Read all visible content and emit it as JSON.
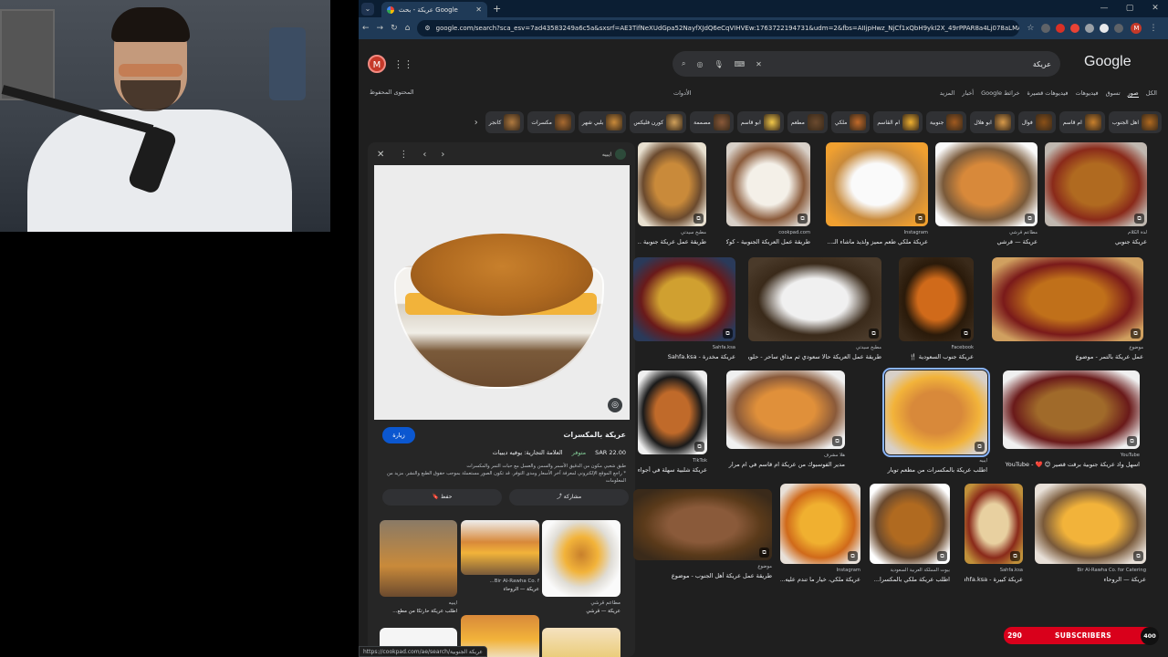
{
  "browser": {
    "tab_title": "عريكة - بحث Google",
    "url": "google.com/search?sca_esv=7ad43583249a6c5a&sxsrf=AE3TifNeXUdGpa52NayfXJdQ6eCqVIHVEw:1763722194731&udm=2&fbs=AIIjpHwz_NjCf1xQbH9ykI2X_49rPPAR8a4Lj078aLMASzH9gHKJW...",
    "status_url": "https://cookpad.com/ae/search/عريكة الجنوبية"
  },
  "google": {
    "logo": "Google",
    "query": "عريكة",
    "avatar_letter": "M",
    "safe_search": "المحتوى المحفوظ",
    "tools": "الأدوات",
    "filters": [
      "الكل",
      "صور",
      "تسوق",
      "فيديوهات",
      "فيديوهات قصيرة",
      "خرائط Google",
      "أخبار",
      "المزيد"
    ],
    "active_filter": "صور"
  },
  "chips": [
    "اهل الجنوب",
    "ام قاسم",
    "فوال",
    "ابو هلال",
    "جنوبية",
    "ام القاسم",
    "ملكي",
    "مطعم",
    "ابو قاسم",
    "مصممة",
    "كورن فليكس",
    "بلبي شهر",
    "مكسرات",
    "كانجر"
  ],
  "preview": {
    "source": "ايبيه",
    "title": "عريكة بالمكسرات",
    "visit": "زيارة",
    "price": "SAR 22.00",
    "stock": "متوفر",
    "brand": "العلامة التجارية: يوفيه ديبيات",
    "desc1": "طبق شعبي مكون من الدقيق الأسمر والسمن والعسل مع حبات التمر والمكسرات",
    "desc2": "* راجع الموقع الإلكتروني لمعرفة آخر الأسعار ومدى التوفر. قد تكون الصور مستعملة بموجب حقوق الطبع والنشر. مزيد من المعلومات",
    "share": "مشاركة",
    "save": "حفظ",
    "related": [
      {
        "src": "ايبيه",
        "title": "اطلب عريكة حارتكا من مطع..."
      },
      {
        "src": "Bir Al-Rawha Co. f...",
        "title": "عريكة — الروحاء"
      },
      {
        "src": "مطاعم قرشي",
        "title": "عريكة — قرشي"
      }
    ]
  },
  "grid": [
    {
      "src": "مطبخ سيدتي",
      "title": "طريقة عمل عريكة جنوبية ..."
    },
    {
      "src": "cookpad.com",
      "title": "طريقة عمل العريكة الجنوبية - كوكباد"
    },
    {
      "src": "Instagram",
      "title": "عريكة ملكي طعم مميز ولذيذ ماشاء الـ..."
    },
    {
      "src": "مطاعم قرشي",
      "title": "عريكة — قرشي",
      "stock": "متوفر"
    },
    {
      "src": "لذة الكلام",
      "title": "عريكة جنوبي"
    },
    {
      "src": "Sahfa.ksa",
      "title": "عريكة مخدرة - Sahfa.ksa",
      "stock": "متوفر"
    },
    {
      "src": "مطبخ سيدتي",
      "title": "طريقة عمل العريكة حالا سعودي ثم مذاق ساحر - حلويات"
    },
    {
      "src": "Facebook",
      "title": "عريكة جنوب السعودية 🍴"
    },
    {
      "src": "موضوع",
      "title": "عمل عريكة بالتمر - موضوع"
    },
    {
      "src": "TikTok",
      "title": "عريكة شلبية سهلة في أجواء ..."
    },
    {
      "src": "هلا مشرف",
      "title": "مدير الفوسبوك من عريكة ام قاسم في ام مرار | هلكريشين ال..."
    },
    {
      "src": "ايبيه",
      "title": "اطلب عريكة بالمكسرات من مطعم تويار",
      "stock": "متوفر"
    },
    {
      "src": "YouTube",
      "title": "اسهل واذ عريكة جنوبية برقت قصير 😊 ❤️ - YouTube"
    },
    {
      "src": "موضوع",
      "title": "طريقة عمل عريكة أهل الجنوب - موضوع"
    },
    {
      "src": "Instagram",
      "title": "عريكة ملكي، خيار ما تندم عليه..."
    },
    {
      "src": "بيوت المملكة العربية السعودية",
      "title": "اطلب عريكة ملكي بالمكسرا..."
    },
    {
      "src": "Sahfa.ksa",
      "title": "عريكة كبيرة - Sahfa.ksa",
      "stock": "متوفر"
    },
    {
      "src": "Bir Al-Rawha Co. for Catering",
      "title": "عريكة — الروحاء",
      "stock": "متوفر"
    }
  ],
  "subscribers": {
    "current": "290",
    "label": "SUBSCRIBERS",
    "goal": "400"
  }
}
